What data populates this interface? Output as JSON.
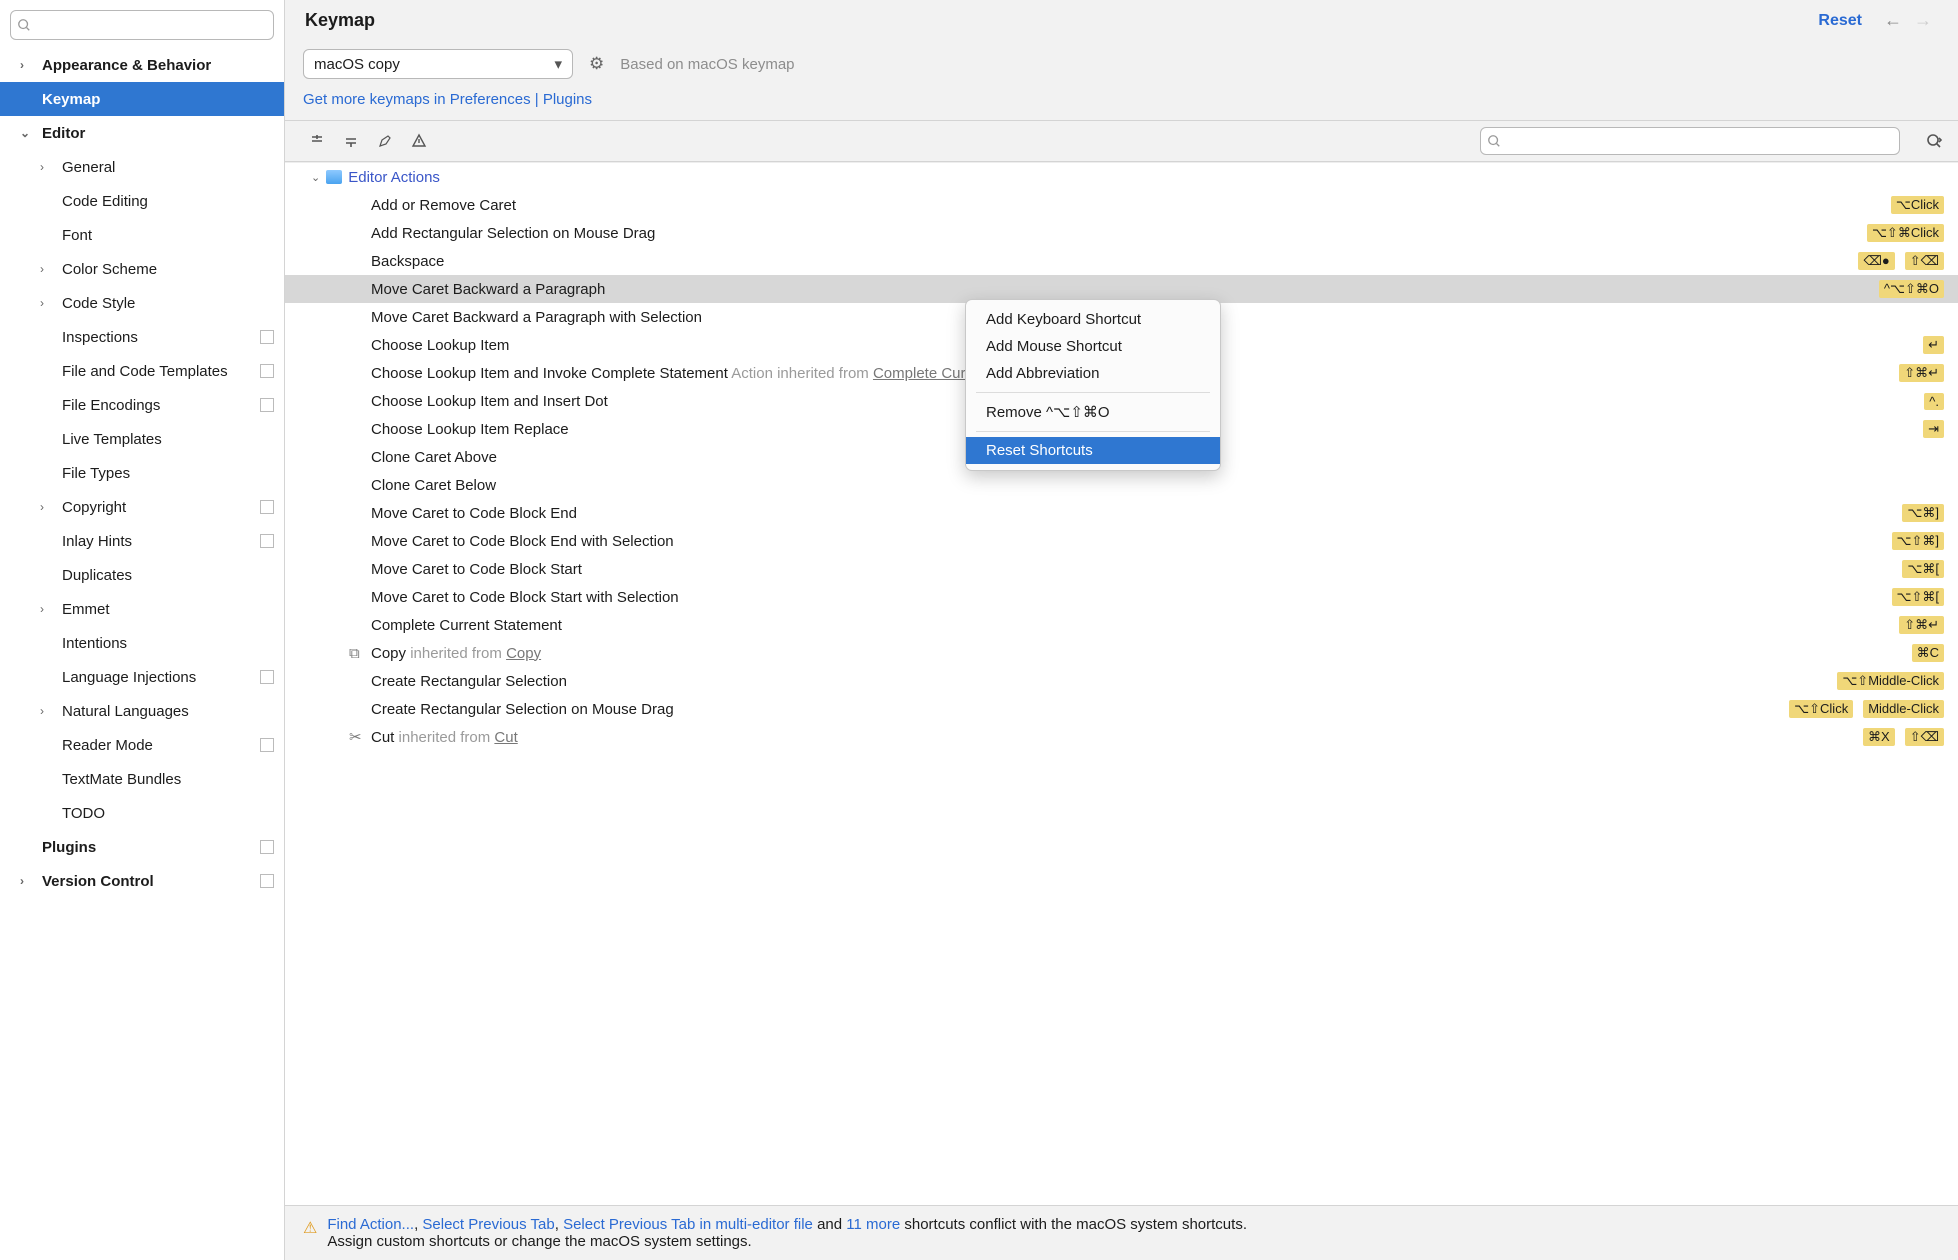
{
  "header": {
    "title": "Keymap",
    "reset": "Reset"
  },
  "sidebar": {
    "items": [
      {
        "label": "Appearance & Behavior",
        "lvl": 1,
        "chev": "›"
      },
      {
        "label": "Keymap",
        "lvl": 1,
        "chev": "",
        "selected": true
      },
      {
        "label": "Editor",
        "lvl": 1,
        "chev": "⌄"
      },
      {
        "label": "General",
        "lvl": 2,
        "chev": "›"
      },
      {
        "label": "Code Editing",
        "lvl": 2,
        "chev": ""
      },
      {
        "label": "Font",
        "lvl": 2,
        "chev": ""
      },
      {
        "label": "Color Scheme",
        "lvl": 2,
        "chev": "›"
      },
      {
        "label": "Code Style",
        "lvl": 2,
        "chev": "›"
      },
      {
        "label": "Inspections",
        "lvl": 2,
        "chev": "",
        "sq": true
      },
      {
        "label": "File and Code Templates",
        "lvl": 2,
        "chev": "",
        "sq": true
      },
      {
        "label": "File Encodings",
        "lvl": 2,
        "chev": "",
        "sq": true
      },
      {
        "label": "Live Templates",
        "lvl": 2,
        "chev": ""
      },
      {
        "label": "File Types",
        "lvl": 2,
        "chev": ""
      },
      {
        "label": "Copyright",
        "lvl": 2,
        "chev": "›",
        "sq": true
      },
      {
        "label": "Inlay Hints",
        "lvl": 2,
        "chev": "",
        "sq": true
      },
      {
        "label": "Duplicates",
        "lvl": 2,
        "chev": ""
      },
      {
        "label": "Emmet",
        "lvl": 2,
        "chev": "›"
      },
      {
        "label": "Intentions",
        "lvl": 2,
        "chev": ""
      },
      {
        "label": "Language Injections",
        "lvl": 2,
        "chev": "",
        "sq": true
      },
      {
        "label": "Natural Languages",
        "lvl": 2,
        "chev": "›"
      },
      {
        "label": "Reader Mode",
        "lvl": 2,
        "chev": "",
        "sq": true
      },
      {
        "label": "TextMate Bundles",
        "lvl": 2,
        "chev": ""
      },
      {
        "label": "TODO",
        "lvl": 2,
        "chev": ""
      },
      {
        "label": "Plugins",
        "lvl": 1,
        "chev": "",
        "sq": true
      },
      {
        "label": "Version Control",
        "lvl": 1,
        "chev": "›",
        "sq": true
      }
    ]
  },
  "keymap": {
    "selected": "macOS copy",
    "based_on": "Based on macOS keymap",
    "morelinks_a": "Get more keymaps in Preferences | Plugins",
    "group_header": "Editor Actions",
    "actions": [
      {
        "name": "Add or Remove Caret",
        "sc": [
          "⌥Click"
        ]
      },
      {
        "name": "Add Rectangular Selection on Mouse Drag",
        "sc": [
          "⌥⇧⌘Click"
        ]
      },
      {
        "name": "Backspace",
        "sc": [
          "⌫●",
          "⇧⌫"
        ]
      },
      {
        "name": "Move Caret Backward a Paragraph",
        "sc": [
          "^⌥⇧⌘O"
        ],
        "selected": true
      },
      {
        "name": "Move Caret Backward a Paragraph with Selection"
      },
      {
        "name": "Choose Lookup Item",
        "sc": [
          "↵"
        ]
      },
      {
        "name": "Choose Lookup Item and Invoke Complete Statement",
        "inh": "Complete Current Statement",
        "inhprefix": "Action inherited from ",
        "sc": [
          "⇧⌘↵"
        ]
      },
      {
        "name": "Choose Lookup Item and Insert Dot",
        "sc": [
          "^."
        ]
      },
      {
        "name": "Choose Lookup Item Replace",
        "sc": [
          "⇥"
        ]
      },
      {
        "name": "Clone Caret Above"
      },
      {
        "name": "Clone Caret Below"
      },
      {
        "name": "Move Caret to Code Block End",
        "sc": [
          "⌥⌘]"
        ]
      },
      {
        "name": "Move Caret to Code Block End with Selection",
        "sc": [
          "⌥⇧⌘]"
        ]
      },
      {
        "name": "Move Caret to Code Block Start",
        "sc": [
          "⌥⌘["
        ]
      },
      {
        "name": "Move Caret to Code Block Start with Selection",
        "sc": [
          "⌥⇧⌘["
        ]
      },
      {
        "name": "Complete Current Statement",
        "sc": [
          "⇧⌘↵"
        ]
      },
      {
        "name": "Copy",
        "icon": "copy",
        "inhprefix": "inherited from ",
        "inh": "Copy",
        "sc": [
          "⌘C"
        ]
      },
      {
        "name": "Create Rectangular Selection",
        "sc": [
          "⌥⇧Middle-Click"
        ]
      },
      {
        "name": "Create Rectangular Selection on Mouse Drag",
        "sc": [
          "⌥⇧Click",
          "Middle-Click"
        ]
      },
      {
        "name": "Cut",
        "icon": "cut",
        "inhprefix": "inherited from ",
        "inh": "Cut",
        "sc": [
          "⌘X",
          "⇧⌫"
        ]
      }
    ]
  },
  "context_menu": {
    "items": [
      "Add Keyboard Shortcut",
      "Add Mouse Shortcut",
      "Add Abbreviation"
    ],
    "remove": "Remove ^⌥⇧⌘O",
    "reset": "Reset Shortcuts"
  },
  "footer": {
    "links": [
      "Find Action...",
      "Select Previous Tab",
      "Select Previous Tab in multi-editor file"
    ],
    "and": " and ",
    "more": "11 more",
    "tail": " shortcuts conflict with the macOS system shortcuts.",
    "line2": "Assign custom shortcuts or change the macOS system settings."
  }
}
